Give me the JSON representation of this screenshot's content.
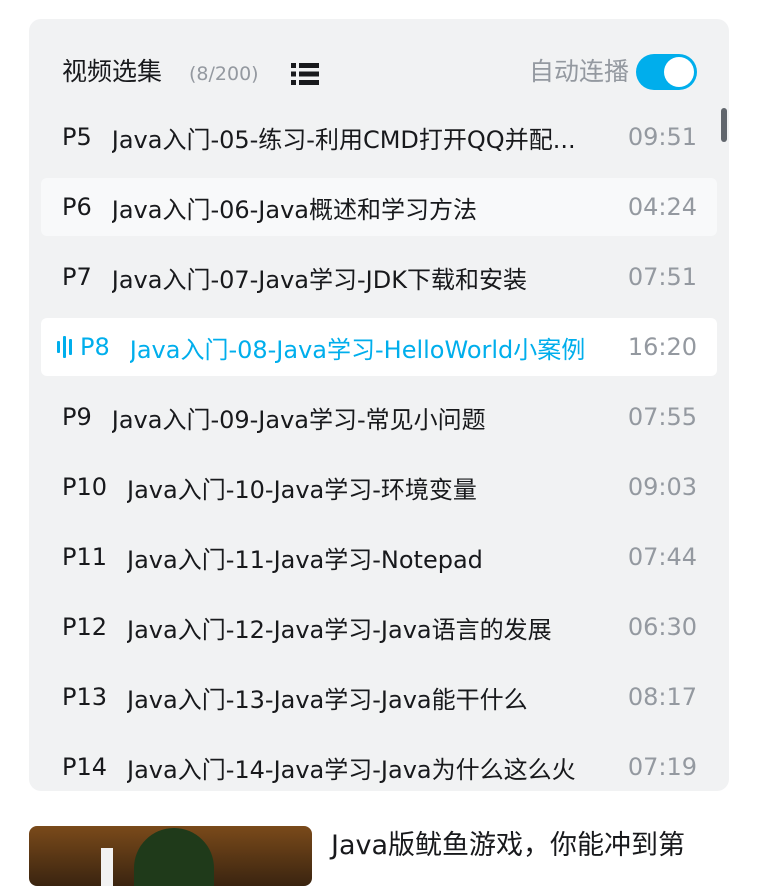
{
  "header": {
    "title": "视频选集",
    "count": "(8/200)",
    "list_icon": "list-icon",
    "autoplay_label": "自动连播",
    "autoplay_on": true,
    "accent_color": "#00aeec"
  },
  "episodes": [
    {
      "ep": "P5",
      "name": "Java入门-05-练习-利用CMD打开QQ并配...",
      "duration": "09:51"
    },
    {
      "ep": "P6",
      "name": "Java入门-06-Java概述和学习方法",
      "duration": "04:24"
    },
    {
      "ep": "P7",
      "name": "Java入门-07-Java学习-JDK下载和安装",
      "duration": "07:51"
    },
    {
      "ep": "P8",
      "name": "Java入门-08-Java学习-HelloWorld小案例",
      "duration": "16:20"
    },
    {
      "ep": "P9",
      "name": "Java入门-09-Java学习-常见小问题",
      "duration": "07:55"
    },
    {
      "ep": "P10",
      "name": "Java入门-10-Java学习-环境变量",
      "duration": "09:03"
    },
    {
      "ep": "P11",
      "name": "Java入门-11-Java学习-Notepad",
      "duration": "07:44"
    },
    {
      "ep": "P12",
      "name": "Java入门-12-Java学习-Java语言的发展",
      "duration": "06:30"
    },
    {
      "ep": "P13",
      "name": "Java入门-13-Java学习-Java能干什么",
      "duration": "08:17"
    },
    {
      "ep": "P14",
      "name": "Java入门-14-Java学习-Java为什么这么火",
      "duration": "07:19"
    }
  ],
  "related": {
    "title": "Java版鱿鱼游戏，你能冲到第"
  }
}
